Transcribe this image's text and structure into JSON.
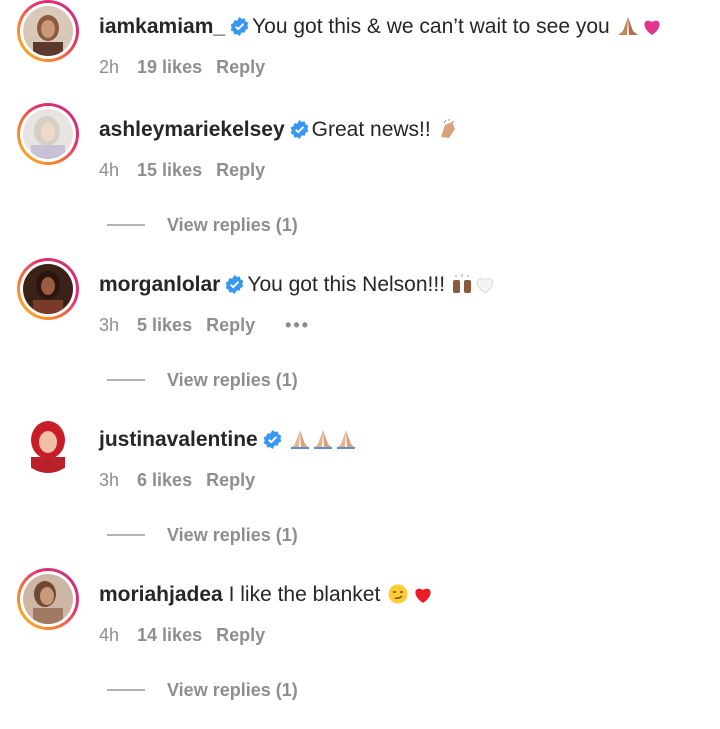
{
  "comments": [
    {
      "username": "iamkamiam_",
      "verified": true,
      "text": "You got this & we can’t wait to see you",
      "time": "2h",
      "likes": "19 likes",
      "reply": "Reply",
      "view_replies": ""
    },
    {
      "username": "ashleymariekelsey",
      "verified": true,
      "text": "Great news!!",
      "time": "4h",
      "likes": "15 likes",
      "reply": "Reply",
      "view_replies": "View replies (1)"
    },
    {
      "username": "morganlolar",
      "verified": true,
      "text": "You got this Nelson!!!",
      "time": "3h",
      "likes": "5 likes",
      "reply": "Reply",
      "more": "•••",
      "view_replies": "View replies (1)"
    },
    {
      "username": "justinavalentine",
      "verified": true,
      "text": "",
      "time": "3h",
      "likes": "6 likes",
      "reply": "Reply",
      "view_replies": "View replies (1)"
    },
    {
      "username": "moriahjadea",
      "verified": false,
      "text": "I like the blanket",
      "time": "4h",
      "likes": "14 likes",
      "reply": "Reply",
      "view_replies": "View replies (1)"
    }
  ],
  "icons": {
    "verified": "verified-badge-icon",
    "emojis": [
      "folded-hands-icon",
      "pink-heart-icon",
      "clapping-hands-icon",
      "raising-hands-icon",
      "white-heart-icon",
      "smirking-face-icon",
      "red-heart-icon"
    ]
  },
  "colors": {
    "verified_blue": "#3897f0",
    "meta_gray": "#8e8e8e",
    "text": "#262626",
    "heart_red": "#ed1c24",
    "heart_pink": "#e0368c"
  }
}
